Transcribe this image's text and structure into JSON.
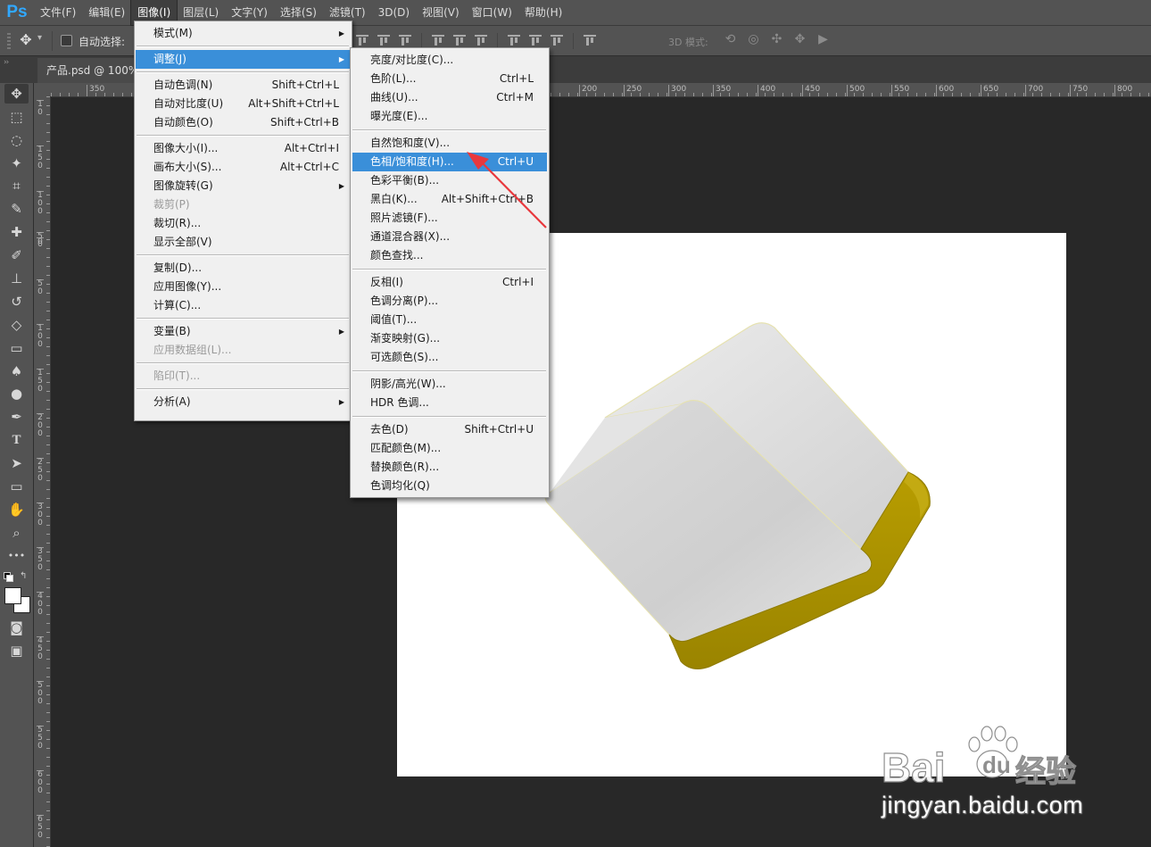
{
  "app": {
    "logo": "Ps"
  },
  "menubar": {
    "items": [
      "文件(F)",
      "编辑(E)",
      "图像(I)",
      "图层(L)",
      "文字(Y)",
      "选择(S)",
      "滤镜(T)",
      "3D(D)",
      "视图(V)",
      "窗口(W)",
      "帮助(H)"
    ],
    "active": "图像(I)"
  },
  "options_bar": {
    "auto_select_label": "自动选择:",
    "auto_select_checked": false,
    "mode_3d_label": "3D 模式:"
  },
  "document_tab": {
    "label": "产品.psd @ 100%"
  },
  "ruler": {
    "top_labels": [
      "350",
      "200",
      "250",
      "300",
      "350",
      "400",
      "450",
      "500",
      "550",
      "600",
      "650",
      "700",
      "750",
      "800"
    ],
    "left_labels": [
      "1 0",
      "1 5 0",
      "1 0 0",
      "5 0",
      "0",
      "5 0",
      "1 0 0",
      "1 5 0",
      "2 0 0",
      "2 5 0",
      "3 0 0",
      "3 5 0",
      "4 0 0",
      "4 5 0",
      "5 0 0",
      "5 5 0",
      "6 0 0",
      "6 5 0"
    ]
  },
  "toolbox": {
    "tools": [
      "move-tool",
      "marquee-tool",
      "lasso-tool",
      "magic-wand-tool",
      "crop-tool",
      "eyedropper-tool",
      "healing-tool",
      "brush-tool",
      "stamp-tool",
      "history-brush-tool",
      "eraser-tool",
      "gradient-tool",
      "blur-tool",
      "dodge-tool",
      "pen-tool",
      "type-tool",
      "path-select-tool",
      "rectangle-tool",
      "hand-tool",
      "zoom-tool",
      "more-tools",
      "quick-mask",
      "screen-mode"
    ],
    "foreground_color": "#ffffff",
    "background_color": "#ffffff"
  },
  "image_menu": {
    "items": [
      {
        "label": "模式(M)",
        "shortcut": "",
        "submenu": true
      },
      {
        "separator": true
      },
      {
        "label": "调整(J)",
        "shortcut": "",
        "submenu": true,
        "highlighted": true
      },
      {
        "separator": true
      },
      {
        "label": "自动色调(N)",
        "shortcut": "Shift+Ctrl+L"
      },
      {
        "label": "自动对比度(U)",
        "shortcut": "Alt+Shift+Ctrl+L"
      },
      {
        "label": "自动颜色(O)",
        "shortcut": "Shift+Ctrl+B"
      },
      {
        "separator": true
      },
      {
        "label": "图像大小(I)...",
        "shortcut": "Alt+Ctrl+I"
      },
      {
        "label": "画布大小(S)...",
        "shortcut": "Alt+Ctrl+C"
      },
      {
        "label": "图像旋转(G)",
        "shortcut": "",
        "submenu": true
      },
      {
        "label": "裁剪(P)",
        "shortcut": "",
        "disabled": true
      },
      {
        "label": "裁切(R)...",
        "shortcut": ""
      },
      {
        "label": "显示全部(V)",
        "shortcut": ""
      },
      {
        "separator": true
      },
      {
        "label": "复制(D)...",
        "shortcut": ""
      },
      {
        "label": "应用图像(Y)...",
        "shortcut": ""
      },
      {
        "label": "计算(C)...",
        "shortcut": ""
      },
      {
        "separator": true
      },
      {
        "label": "变量(B)",
        "shortcut": "",
        "submenu": true
      },
      {
        "label": "应用数据组(L)...",
        "shortcut": "",
        "disabled": true
      },
      {
        "separator": true
      },
      {
        "label": "陷印(T)...",
        "shortcut": "",
        "disabled": true
      },
      {
        "separator": true
      },
      {
        "label": "分析(A)",
        "shortcut": "",
        "submenu": true
      }
    ]
  },
  "adjust_menu": {
    "items": [
      {
        "label": "亮度/对比度(C)...",
        "shortcut": ""
      },
      {
        "label": "色阶(L)...",
        "shortcut": "Ctrl+L"
      },
      {
        "label": "曲线(U)...",
        "shortcut": "Ctrl+M"
      },
      {
        "label": "曝光度(E)...",
        "shortcut": ""
      },
      {
        "separator": true
      },
      {
        "label": "自然饱和度(V)...",
        "shortcut": ""
      },
      {
        "label": "色相/饱和度(H)...",
        "shortcut": "Ctrl+U",
        "highlighted": true
      },
      {
        "label": "色彩平衡(B)...",
        "shortcut": ""
      },
      {
        "label": "黑白(K)...",
        "shortcut": "Alt+Shift+Ctrl+B"
      },
      {
        "label": "照片滤镜(F)...",
        "shortcut": ""
      },
      {
        "label": "通道混合器(X)...",
        "shortcut": ""
      },
      {
        "label": "颜色查找...",
        "shortcut": ""
      },
      {
        "separator": true
      },
      {
        "label": "反相(I)",
        "shortcut": "Ctrl+I"
      },
      {
        "label": "色调分离(P)...",
        "shortcut": ""
      },
      {
        "label": "阈值(T)...",
        "shortcut": ""
      },
      {
        "label": "渐变映射(G)...",
        "shortcut": ""
      },
      {
        "label": "可选颜色(S)...",
        "shortcut": ""
      },
      {
        "separator": true
      },
      {
        "label": "阴影/高光(W)...",
        "shortcut": ""
      },
      {
        "label": "HDR 色调...",
        "shortcut": ""
      },
      {
        "separator": true
      },
      {
        "label": "去色(D)",
        "shortcut": "Shift+Ctrl+U"
      },
      {
        "label": "匹配颜色(M)...",
        "shortcut": ""
      },
      {
        "label": "替换颜色(R)...",
        "shortcut": ""
      },
      {
        "label": "色调均化(Q)",
        "shortcut": ""
      }
    ]
  },
  "canvas": {
    "background": "#ffffff",
    "product_colors": {
      "top": "#dcdcdc",
      "front": "#d2d2d2",
      "side": "#b39a00"
    }
  },
  "annotation": {
    "arrow_color": "#e8383d"
  },
  "watermark": {
    "logo_text": "Baidu 经验",
    "url": "jingyan.baidu.com"
  },
  "colors": {
    "menu_highlight": "#3a8fd9",
    "app_chrome": "#535353",
    "workspace": "#282828"
  }
}
